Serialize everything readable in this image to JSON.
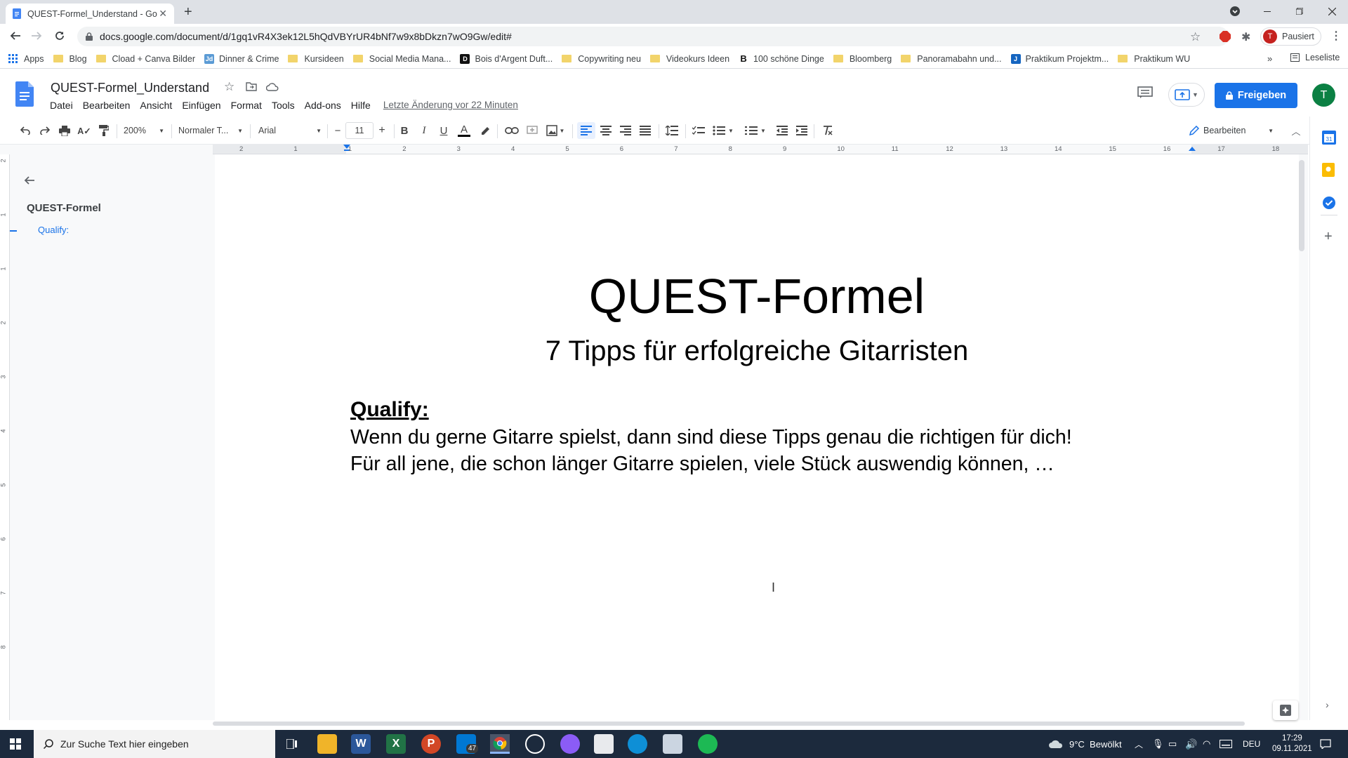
{
  "browser": {
    "tab_title": "QUEST-Formel_Understand - Go",
    "url": "docs.google.com/document/d/1gq1vR4X3ek12L5hQdVBYrUR4bNf7w9x8bDkzn7wO9Gw/edit#",
    "profile_label": "Pausiert",
    "profile_initial": "T",
    "bookmarks": [
      {
        "label": "Apps",
        "icon": "apps-grid-icon"
      },
      {
        "label": "Blog",
        "icon": "folder-icon"
      },
      {
        "label": "Cload + Canva Bilder",
        "icon": "folder-icon"
      },
      {
        "label": "Dinner & Crime",
        "icon": "jd-favicon"
      },
      {
        "label": "Kursideen",
        "icon": "folder-icon"
      },
      {
        "label": "Social Media Mana...",
        "icon": "folder-icon"
      },
      {
        "label": "Bois d'Argent Duft...",
        "icon": "dior-favicon"
      },
      {
        "label": "Copywriting neu",
        "icon": "folder-icon"
      },
      {
        "label": "Videokurs Ideen",
        "icon": "folder-icon"
      },
      {
        "label": "100 schöne Dinge",
        "icon": "b-favicon"
      },
      {
        "label": "Bloomberg",
        "icon": "folder-icon"
      },
      {
        "label": "Panoramabahn und...",
        "icon": "folder-icon"
      },
      {
        "label": "Praktikum Projektm...",
        "icon": "j-favicon"
      },
      {
        "label": "Praktikum WU",
        "icon": "folder-icon"
      }
    ],
    "reading_list": "Leseliste"
  },
  "docs": {
    "title": "QUEST-Formel_Understand",
    "menus": [
      "Datei",
      "Bearbeiten",
      "Ansicht",
      "Einfügen",
      "Format",
      "Tools",
      "Add-ons",
      "Hilfe"
    ],
    "last_edit": "Letzte Änderung vor 22 Minuten",
    "share_label": "Freigeben",
    "user_initial": "T",
    "toolbar": {
      "zoom": "200%",
      "style": "Normaler T...",
      "font": "Arial",
      "font_size": "11",
      "mode": "Bearbeiten"
    },
    "ruler_numbers": [
      "2",
      "1",
      "1",
      "2",
      "3",
      "4",
      "5",
      "6",
      "7",
      "8",
      "9",
      "10",
      "11",
      "12",
      "13",
      "14",
      "15",
      "16",
      "17",
      "18"
    ],
    "vruler_numbers": [
      "2",
      "1",
      "1",
      "2",
      "3",
      "4",
      "5",
      "6",
      "7",
      "8"
    ],
    "outline": {
      "title": "QUEST-Formel",
      "items": [
        "Qualify:"
      ]
    },
    "content": {
      "title": "QUEST-Formel",
      "subtitle": "7 Tipps für erfolgreiche Gitarristen",
      "heading": "Qualify:",
      "line1": "Wenn du gerne Gitarre spielst, dann sind diese Tipps genau die richtigen für dich!",
      "line2": "Für all jene, die schon länger Gitarre spielen, viele Stück auswendig können, …"
    }
  },
  "taskbar": {
    "search_placeholder": "Zur Suche Text hier eingeben",
    "mail_badge": "47",
    "weather": "9°C  Bewölkt",
    "language": "DEU",
    "time": "17:29",
    "date": "09.11.2021"
  },
  "colors": {
    "accent": "#1a73e8",
    "chrome_bg": "#dee1e6",
    "taskbar_bg": "#1c2a3d",
    "avatar_green": "#0b8043"
  }
}
